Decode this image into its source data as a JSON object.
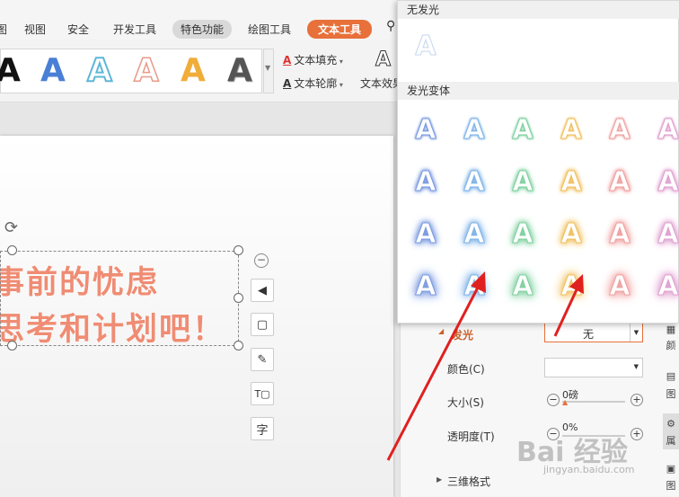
{
  "menu": {
    "items": [
      "图",
      "视图",
      "安全",
      "开发工具",
      "特色功能",
      "绘图工具",
      "文本工具"
    ],
    "search_icon": "search-icon"
  },
  "ribbon": {
    "text_fill": "文本填充",
    "text_outline": "文本轮廓",
    "text_effect": "文本效果",
    "style_glyph": "A"
  },
  "slide": {
    "line1": "事前的忧虑",
    "line2": "思考和计划吧！"
  },
  "popup": {
    "no_glow_header": "无发光",
    "variants_header": "发光变体",
    "glyph": "A",
    "glow_colors": [
      "#7a9ae0",
      "#7fb3e8",
      "#7fd0a0",
      "#f0c060",
      "#f0a0a0",
      "#e0a0d0"
    ]
  },
  "panel": {
    "glow_label": "发光",
    "glow_value": "无",
    "color_label": "颜色(C)",
    "size_label": "大小(S)",
    "size_value": "0磅",
    "transparency_label": "透明度(T)",
    "transparency_value": "0%",
    "three_d_label": "三维格式",
    "side_tabs": [
      "颜",
      "图",
      "属",
      "图"
    ]
  },
  "watermark": {
    "main": "Bai 经验",
    "sub": "jingyan.baidu.com"
  },
  "colors": {
    "accent": "#e8703a",
    "arrow": "#e02020",
    "slide_text": "#ef8c73"
  }
}
